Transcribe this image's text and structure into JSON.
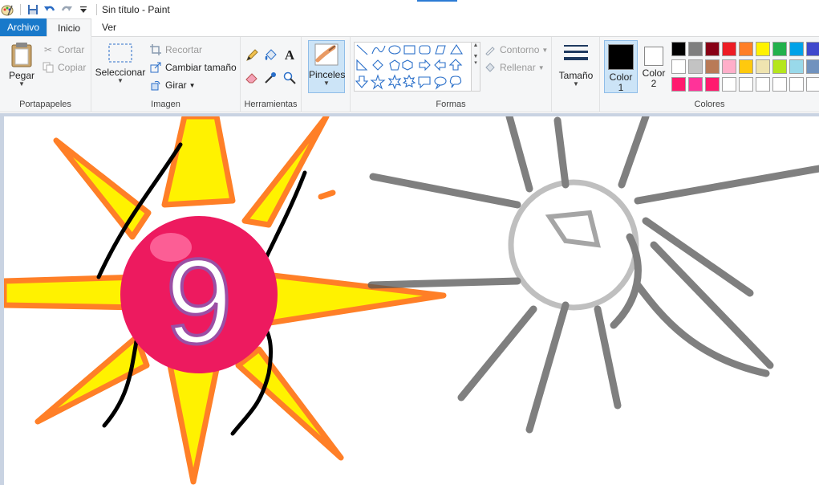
{
  "window": {
    "title": "Sin título - Paint"
  },
  "tabs": [
    {
      "label": "Archivo"
    },
    {
      "label": "Inicio"
    },
    {
      "label": "Ver"
    }
  ],
  "clipboard": {
    "paste": "Pegar",
    "cut": "Cortar",
    "copy": "Copiar",
    "group": "Portapapeles"
  },
  "image": {
    "select": "Seleccionar",
    "crop": "Recortar",
    "resize": "Cambiar tamaño",
    "rotate": "Girar",
    "group": "Imagen"
  },
  "tools": {
    "group": "Herramientas"
  },
  "brushes": {
    "label": "Pinceles"
  },
  "shapes": {
    "outline": "Contorno",
    "fill": "Rellenar",
    "group": "Formas"
  },
  "size": {
    "label": "Tamaño"
  },
  "colors": {
    "color1": "Color 1",
    "color2": "Color 2",
    "group": "Colores",
    "color1_value": "#000000",
    "color2_value": "#ffffff",
    "palette_row1": [
      "#000000",
      "#7f7f7f",
      "#880015",
      "#ed1c24",
      "#ff7f27",
      "#fff200",
      "#22b14c",
      "#00a2e8",
      "#3f48cc"
    ],
    "palette_row2": [
      "#ffffff",
      "#c3c3c3",
      "#b97a57",
      "#ffaec9",
      "#ffc90e",
      "#efe4b0",
      "#b5e61d",
      "#99d9ea",
      "#7092be"
    ],
    "palette_row3": [
      "#ff1a6e",
      "#ff3399",
      "#ff1a6e",
      "#ffffff",
      "#ffffff",
      "#ffffff",
      "#ffffff",
      "#ffffff",
      "#ffffff"
    ]
  },
  "canvas": {
    "digit": "9"
  }
}
